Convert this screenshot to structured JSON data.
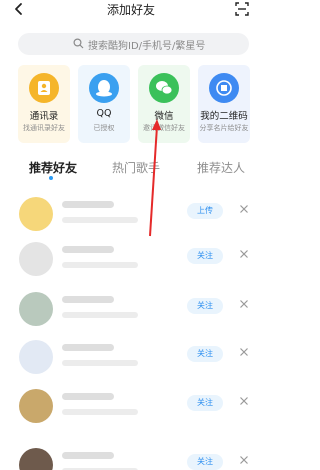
{
  "header": {
    "title": "添加好友"
  },
  "search": {
    "placeholder": "搜索酷狗ID/手机号/繁星号"
  },
  "cards": [
    {
      "name": "通讯录",
      "sub": "找通讯录好友",
      "icon": "contacts-icon",
      "bg": "#fef7e6",
      "icon_color": "#f5b52a"
    },
    {
      "name": "QQ",
      "sub": "已授权",
      "icon": "qq-icon",
      "bg": "#eef6fd",
      "icon_color": "#3aa0f0"
    },
    {
      "name": "微信",
      "sub": "邀请微信好友",
      "icon": "wechat-icon",
      "bg": "#eef9ef",
      "icon_color": "#3bc15a"
    },
    {
      "name": "我的二维码",
      "sub": "分享名片给好友",
      "icon": "qrcode-icon",
      "bg": "#eef3fd",
      "icon_color": "#3e8af2"
    }
  ],
  "tabs": [
    {
      "label": "推荐好友",
      "active": true
    },
    {
      "label": "热门歌手",
      "active": false
    },
    {
      "label": "推荐达人",
      "active": false
    }
  ],
  "rows": [
    {
      "button": "上传",
      "avatar_color": "#f6d77a"
    },
    {
      "button": "关注",
      "avatar_color": "#e4e4e4"
    },
    {
      "button": "关注",
      "avatar_color": "#b9c9bd"
    },
    {
      "button": "关注",
      "avatar_color": "#e2e9f4"
    },
    {
      "button": "关注",
      "avatar_color": "#c9a86b"
    },
    {
      "button": "关注",
      "avatar_color": "#6e5a4c"
    }
  ],
  "colors": {
    "accent": "#2d9cf4",
    "annotation_arrow": "#e52a2a"
  }
}
